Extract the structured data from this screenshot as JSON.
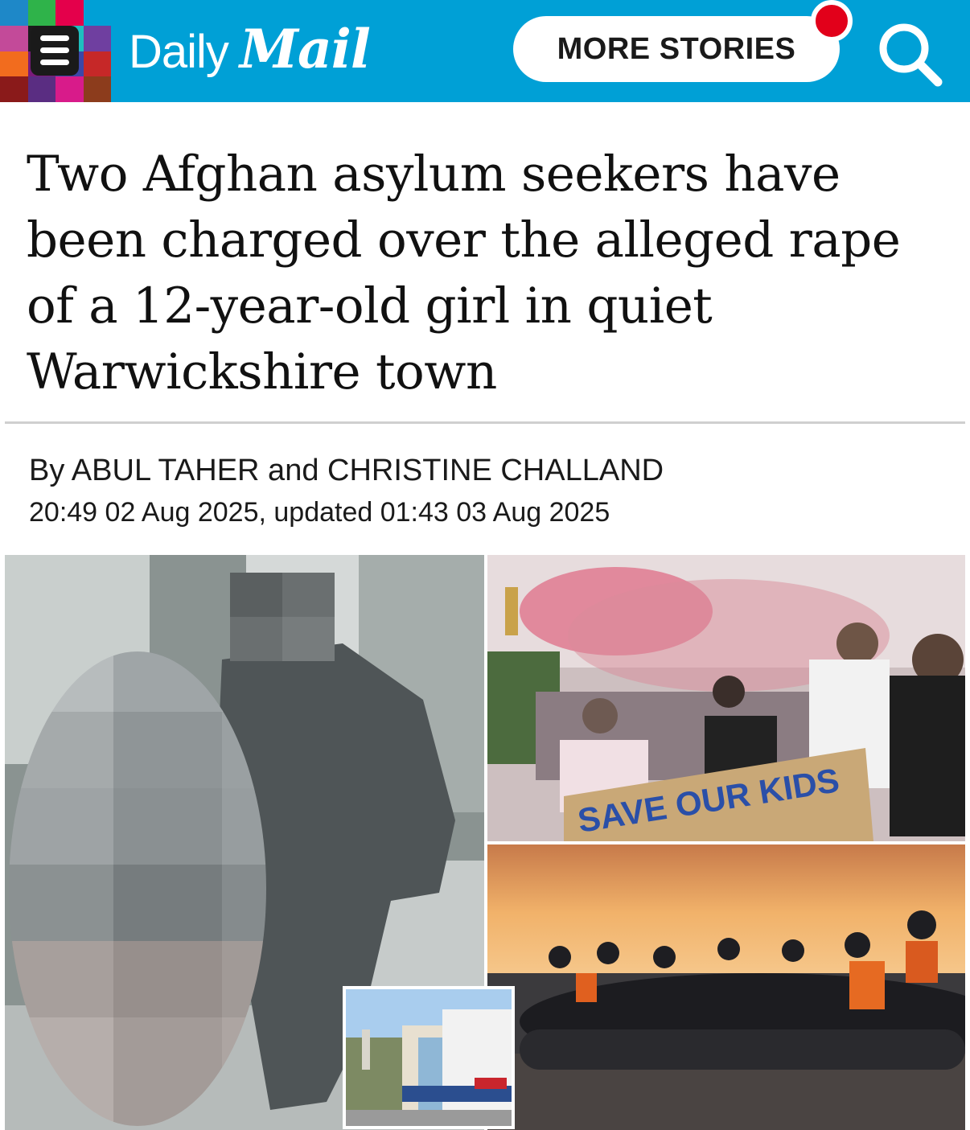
{
  "header": {
    "logo_daily": "Daily",
    "logo_mail": "Mail",
    "more_stories_label": "MORE STORIES",
    "menu_icon": "hamburger-menu-icon",
    "search_icon": "search-icon",
    "background_color": "#00a0d6",
    "notification_color": "#e2001a"
  },
  "article": {
    "headline": "Two Afghan asylum seekers have been charged over the alleged rape of a 12-year-old girl in quiet Warwickshire town",
    "byline": "By ABUL TAHER and CHRISTINE CHALLAND",
    "timestamp": "20:49 02 Aug 2025, updated 01:43 03 Aug 2025"
  },
  "images": {
    "protest_sign_text": "SAVE OUR KIDS"
  }
}
